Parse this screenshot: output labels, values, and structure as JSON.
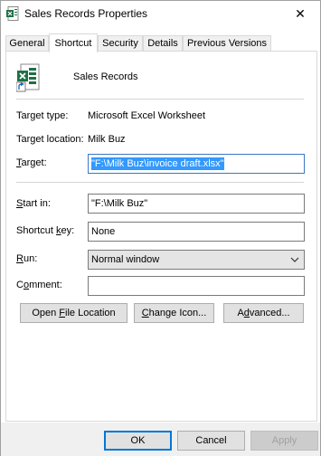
{
  "window": {
    "title": "Sales Records Properties",
    "close_symbol": "✕"
  },
  "tabs": [
    {
      "label": "General",
      "active": false
    },
    {
      "label": "Shortcut",
      "active": true
    },
    {
      "label": "Security",
      "active": false
    },
    {
      "label": "Details",
      "active": false
    },
    {
      "label": "Previous Versions",
      "active": false
    }
  ],
  "header": {
    "shortcut_name": "Sales Records"
  },
  "info": {
    "target_type_label": "Target type:",
    "target_type_value": "Microsoft Excel Worksheet",
    "target_location_label": "Target location:",
    "target_location_value": "Milk Buz"
  },
  "fields": {
    "target_label_prefix": "",
    "target_label_mnemonic": "T",
    "target_label_rest": "arget:",
    "target_value": "\"F:\\Milk Buz\\invoice draft.xlsx\"",
    "start_in_label_prefix": "",
    "start_in_label_mnemonic": "S",
    "start_in_label_rest": "tart in:",
    "start_in_value": "\"F:\\Milk Buz\"",
    "shortcut_key_label_prefix": "Shortcut ",
    "shortcut_key_label_mnemonic": "k",
    "shortcut_key_label_rest": "ey:",
    "shortcut_key_value": "None",
    "run_label_prefix": "",
    "run_label_mnemonic": "R",
    "run_label_rest": "un:",
    "run_value": "Normal window",
    "comment_label_prefix": "C",
    "comment_label_mnemonic": "o",
    "comment_label_rest": "mment:",
    "comment_value": ""
  },
  "actions": {
    "open_location_prefix": "Open ",
    "open_location_mnemonic": "F",
    "open_location_rest": "ile Location",
    "change_icon_prefix": "",
    "change_icon_mnemonic": "C",
    "change_icon_rest": "hange Icon...",
    "advanced_prefix": "A",
    "advanced_mnemonic": "d",
    "advanced_rest": "vanced..."
  },
  "footer": {
    "ok_label": "OK",
    "cancel_label": "Cancel",
    "apply_label": "Apply"
  },
  "colors": {
    "selection": "#3399ff",
    "excel_green": "#1e7145",
    "focus_blue": "#0078d7"
  }
}
